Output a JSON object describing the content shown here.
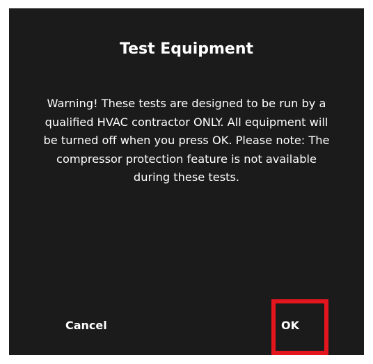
{
  "dialog": {
    "title": "Test Equipment",
    "message": "Warning! These tests are designed to be run by a qualified HVAC contractor ONLY. All equipment will be turned off when you press OK. Please note: The compressor protection feature is not available during these tests.",
    "buttons": {
      "cancel_label": "Cancel",
      "ok_label": "OK"
    }
  },
  "colors": {
    "dialog_background": "#1b1b1b",
    "text": "#ffffff",
    "highlight": "#e3161d"
  }
}
